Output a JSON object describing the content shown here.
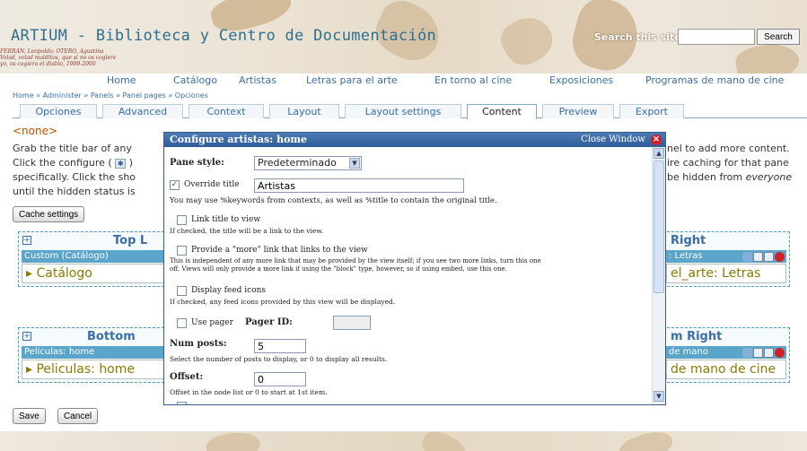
{
  "header": {
    "site_title": "ARTIUM - Biblioteca y Centro de Documentación",
    "quote_line1": "FERRÁN, Leopoldo; OTERO, Agustina",
    "quote_line2": "Volad, volad malditos, que si no os cogiere",
    "quote_line3": "yo, os cogiera el diablo, 1999-2000",
    "search_label": "Search this site:",
    "search_value": "",
    "search_button": "Search"
  },
  "nav": {
    "items": [
      "Home",
      "Catálogo",
      "Artistas",
      "Letras para el arte",
      "En torno al cine",
      "Exposiciones",
      "Programas de mano de cine"
    ]
  },
  "breadcrumb": "Home » Administer » Panels » Panel pages » Opciones",
  "tabs": [
    "Opciones",
    "Advanced",
    "Context",
    "Layout",
    "Layout settings",
    "Content",
    "Preview",
    "Export"
  ],
  "active_tab": "Content",
  "none_label": "<none>",
  "intro": {
    "line1": "Grab the title bar of any",
    "line2": "Click the configure (",
    "line2b": ")",
    "line3": "specifically. Click the sho",
    "line4": "until the hidden status is",
    "r1": "nel to add more content.",
    "r2": "ire caching for that pane",
    "r3": "be hidden from",
    "r3b": "everyone"
  },
  "cache_button": "Cache settings",
  "panes": {
    "top_left": {
      "title": "Top L",
      "bar": "Custom (Catálogo)",
      "item": "▸ Catálogo"
    },
    "top_right": {
      "title": "Right",
      "bar": ": Letras",
      "item": "el_arte: Letras"
    },
    "bottom_left": {
      "title": "Bottom",
      "bar": "Peliculas: home",
      "item": "▸ Peliculas: home"
    },
    "bottom_right": {
      "title": "m Right",
      "bar": "de mano",
      "item": "de mano de cine"
    }
  },
  "save_button": "Save",
  "cancel_button": "Cancel",
  "modal": {
    "title": "Configure artistas: home",
    "close_label": "Close Window",
    "pane_style_label": "Pane style:",
    "pane_style_value": "Predeterminado",
    "override_title_label": "Override title",
    "override_title_checked": true,
    "override_title_value": "Artistas",
    "override_help": "You may use %keywords from contexts, as well as %title to contain the original title.",
    "link_title_label": "Link title to view",
    "link_title_help": "If checked, the title will be a link to the view.",
    "more_link_label": "Provide a \"more\" link that links to the view",
    "more_link_help1": "This is independent of any more link that may be provided by the view itself; if you see two more links, turn this one",
    "more_link_help2": "off. Views will only provide a more link if using the \"block\" type, however, so if using embed, use this one.",
    "feed_icons_label": "Display feed icons",
    "feed_icons_help": "If checked, any feed icons provided by this view will be displayed.",
    "use_pager_label": "Use pager",
    "pager_id_label": "Pager ID:",
    "pager_id_value": "",
    "num_posts_label": "Num posts:",
    "num_posts_value": "5",
    "num_posts_help": "Select the number of posts to display, or 0 to display all results.",
    "offset_label": "Offset:",
    "offset_value": "0",
    "offset_help": "Offset in the node list or 0 to start at 1st item."
  }
}
